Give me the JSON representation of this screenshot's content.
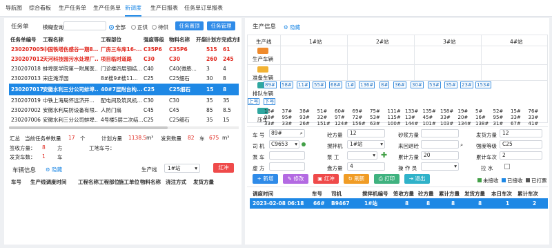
{
  "nav": {
    "tabs": [
      "导航图",
      "综合看板",
      "生产任务单",
      "生产任务单",
      "新调度",
      "生产日报表",
      "任务单订单报表"
    ],
    "active": 4
  },
  "task": {
    "title": "任务单",
    "search_label": "模糊查询",
    "search_value": "",
    "filters": [
      {
        "label": "全部",
        "on": true
      },
      {
        "label": "正供",
        "on": false
      },
      {
        "label": "待供",
        "on": false
      }
    ],
    "btn_pin": "任务置顶",
    "btn_manage": "任务管理",
    "headers": [
      "任务单编号",
      "工程名称",
      "工程部位",
      "强度等级",
      "物料名称",
      "开盘",
      "计划方",
      "完成方量"
    ],
    "rows": [
      {
        "c": [
          "230207005",
          "中国铁塔伤感谷一期8...",
          "厂房三车库16-...",
          "C35P6",
          "C35P6",
          "■",
          "515",
          "61"
        ],
        "style": "red"
      },
      {
        "c": [
          "230207012",
          "天河科技园污水处理厂...",
          "项目临时道路",
          "C30",
          "C30",
          "■",
          "260",
          "245"
        ],
        "style": "red"
      },
      {
        "c": [
          "230207018",
          "蚌埠医学院第一附属医...",
          "门诊楼四层钢结...",
          "C40",
          "C40(微膨...",
          "■",
          "3",
          "4"
        ],
        "style": ""
      },
      {
        "c": [
          "230207013",
          "宋庄滩浮园",
          "8#楼9#楼11...",
          "C25",
          "C25细石",
          "■",
          "30",
          "8"
        ],
        "style": ""
      },
      {
        "c": [
          "230207017",
          "安徽水利三分公司蚌埠...",
          "40#7层附台构...",
          "C25",
          "C25细石",
          "■",
          "15",
          "8"
        ],
        "style": "sel"
      },
      {
        "c": [
          "230207019",
          "中铁上海局怀远济开...",
          "配电间及筑风机...",
          "C30",
          "C30",
          "■",
          "35",
          "35"
        ],
        "style": ""
      },
      {
        "c": [
          "230207002",
          "安徽水利局防设备有限...",
          "人防门扇",
          "C45",
          "C45",
          "■",
          "85",
          "8.5"
        ],
        "style": ""
      },
      {
        "c": [
          "230207006",
          "安徽水利三分公司蚌埠...",
          "4号楼5层二次结...",
          "C25",
          "C25细石",
          "■",
          "35",
          "15"
        ],
        "style": ""
      }
    ]
  },
  "summary": {
    "l1": "汇总",
    "l2": "当前任务单数量",
    "count": "17",
    "unit_count": "个",
    "l3": "计划方量",
    "plan": "1138.5",
    "unit_m3": "m³",
    "l4": "发货数量",
    "ship_num": "82",
    "unit_car": "车",
    "ship_vol": "675",
    "unit_m3b": "m³",
    "l5": "签收方量：",
    "sign": "8",
    "unit_fang": "方",
    "l6": "发货车数：",
    "cars": "1",
    "unit_car2": "车",
    "l7": "工地车号："
  },
  "vehicle": {
    "title": "车辆信息",
    "collapse": "隐藏",
    "line_label": "生产线",
    "line_value": "1#站",
    "btn_red": "红冲",
    "headers": [
      "车号",
      "生产线调度时间",
      "工程名称",
      "工程部位",
      "施工单位",
      "物料名称",
      "浇注方式",
      "发货方量"
    ]
  },
  "production": {
    "title": "生产信息",
    "collapse": "隐藏",
    "col_header": "生产线",
    "stations": [
      "1#站",
      "2#站",
      "3#站",
      "4#站"
    ],
    "row_labels": [
      "生产车辆",
      "准备车辆",
      "排队车辆",
      "压车"
    ],
    "up_btn": "上号",
    "down_btn": "下号",
    "queue_tags": [
      "89#",
      "58#",
      "11#",
      "55#",
      "68#",
      "1#",
      "136#",
      "8#",
      "36#",
      "30#",
      "53#",
      "35#",
      "23#",
      "153#"
    ],
    "press_row1": [
      "18#",
      "37#",
      "38#",
      "51#",
      "60#",
      "69#",
      "75#",
      "111#",
      "133#",
      "135#",
      "158#",
      "19#",
      "5#",
      "52#",
      "15#",
      "76#"
    ],
    "press_row2": [
      "98#",
      "95#",
      "93#",
      "32#",
      "97#",
      "72#",
      "53#",
      "115#",
      "13#",
      "45#",
      "33#",
      "20#",
      "16#",
      "95#",
      "33#",
      "33#"
    ],
    "press_row3": [
      "33#",
      "33#",
      "26#",
      "151#",
      "124#",
      "156#",
      "63#",
      "100#",
      "144#",
      "101#",
      "103#",
      "134#",
      "138#",
      "31#",
      "67#",
      "41#"
    ]
  },
  "dispatch": {
    "car_label": "车  号",
    "car_value": "89#",
    "driver_label": "司  机",
    "driver_value": "C9653",
    "pump_label": "泵  车",
    "pump_value": "",
    "vol_label": "虚  方",
    "vol_value": "",
    "cement_label": "砼方量",
    "cement_value": "12",
    "mixer_label": "搅拌机",
    "mixer_value": "1#站",
    "pumper_label": "泵  工",
    "pumper_value": "",
    "plate_label": "盘方量",
    "plate_value": "4",
    "mortar_label": "砂浆方量",
    "mortar_value": "",
    "return_label": "来回退砼",
    "return_value": "",
    "total_label": "累计方量",
    "total_value": "20",
    "operator_label": "操 作 员",
    "operator_value": "",
    "ship_label": "发货方量",
    "ship_value": "12",
    "grade_label": "强度等级",
    "grade_value": "C25",
    "trips_label": "累计车次",
    "trips_value": "2",
    "pull_label": "拉  水"
  },
  "actions": {
    "new": "新增",
    "edit": "修改",
    "red": "红冲",
    "refresh": "刷新",
    "print": "打印",
    "exit": "退出",
    "legend": [
      {
        "label": "未接收",
        "color": "#43a047"
      },
      {
        "label": "已接收",
        "color": "#1e88e5"
      },
      {
        "label": "已打票",
        "color": "#555555"
      }
    ]
  },
  "log": {
    "headers": [
      "调度时间",
      "车号",
      "司机",
      "搅拌机编号",
      "签收方量",
      "砼方量",
      "累计方量",
      "发货方量",
      "本日车次",
      "累计车次"
    ],
    "rows": [
      {
        "c": [
          "2023-02-08 06:18",
          "66#",
          "B9467",
          "1#站",
          "8",
          "8",
          "8",
          "8",
          "1",
          "2"
        ]
      }
    ]
  },
  "colors": {
    "accent": "#1e88e5",
    "red": "#e0261c",
    "sel": "#1e88e5"
  }
}
